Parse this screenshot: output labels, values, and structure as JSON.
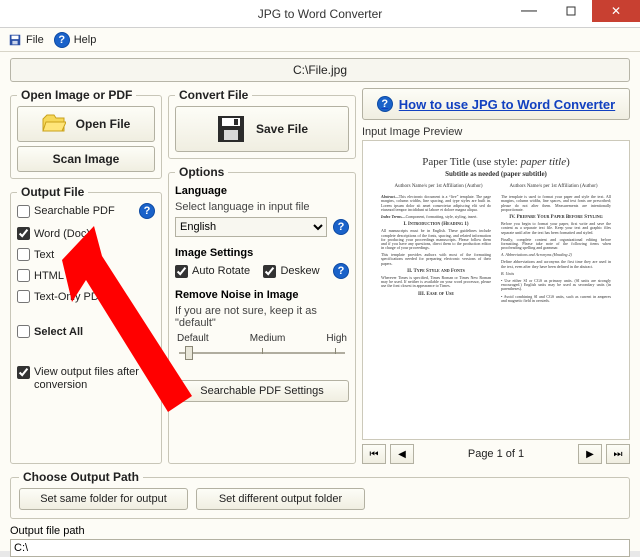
{
  "window": {
    "title": "JPG to Word Converter"
  },
  "menu": {
    "file": "File",
    "help": "Help"
  },
  "pathbar": {
    "text": "C:\\File.jpg"
  },
  "open_group": {
    "title": "Open Image or PDF",
    "open_btn": "Open File",
    "scan_btn": "Scan Image"
  },
  "convert_group": {
    "title": "Convert File",
    "save_btn": "Save File"
  },
  "howto": {
    "label": "How to use JPG to Word Converter"
  },
  "output_file": {
    "title": "Output File",
    "items": {
      "pdf": {
        "label": "Searchable PDF",
        "checked": false
      },
      "word": {
        "label": "Word (Doc)",
        "checked": true
      },
      "text": {
        "label": "Text",
        "checked": false
      },
      "html": {
        "label": "HTML",
        "checked": false
      },
      "txtpdf": {
        "label": "Text-Only PDF",
        "checked": false
      }
    },
    "select_all": {
      "label": "Select All",
      "checked": false
    },
    "view_after": {
      "label": "View output files after conversion",
      "checked": true
    }
  },
  "options": {
    "title": "Options",
    "language": {
      "label": "Language",
      "hint": "Select language in input file",
      "value": "English"
    },
    "image_settings": {
      "label": "Image Settings",
      "auto_rotate": {
        "label": "Auto Rotate",
        "checked": true
      },
      "deskew": {
        "label": "Deskew",
        "checked": true
      }
    },
    "noise": {
      "label": "Remove Noise in Image",
      "hint": "If you are not sure, keep it as \"default\"",
      "ticks": {
        "default": "Default",
        "medium": "Medium",
        "high": "High"
      },
      "value": "default"
    },
    "searchable_btn": "Searchable PDF Settings"
  },
  "choose_path": {
    "title": "Choose Output Path",
    "same_btn": "Set same folder for output",
    "diff_btn": "Set different output folder"
  },
  "output_path": {
    "label": "Output file path",
    "value": "C:\\"
  },
  "preview": {
    "legend": "Input Image Preview",
    "page_label": "Page 1 of 1",
    "mock": {
      "title": "Paper Title (use style: paper title)",
      "subtitle": "Subtitle as needed (paper subtitle)",
      "author_block": "Authors Name/s per 1st Affiliation (Author)"
    }
  },
  "colors": {
    "accent": "#1140c0",
    "danger_bg": "#c84031"
  }
}
